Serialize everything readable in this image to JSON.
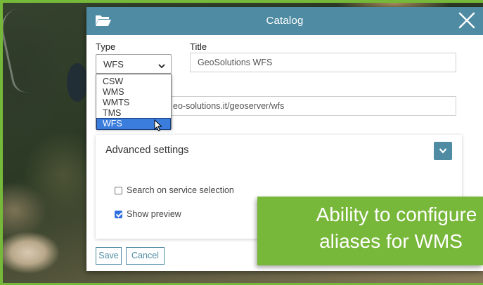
{
  "dialog": {
    "title": "Catalog",
    "icons": {
      "header": "folder-open-icon",
      "close": "close-icon",
      "toggle": "chevron-down-icon",
      "cursor": "mouse-pointer-icon"
    },
    "header_color": "#4f8ba3"
  },
  "form": {
    "type_label": "Type",
    "type_value": "WFS",
    "type_options": [
      "CSW",
      "WMS",
      "WMTS",
      "TMS",
      "WFS"
    ],
    "selected_option": "WFS",
    "title_label": "Title",
    "title_value": "GeoSolutions WFS",
    "url_value": "eo-solutions.it/geoserver/wfs"
  },
  "advanced": {
    "heading": "Advanced settings",
    "options": [
      {
        "label": "Search on service selection",
        "checked": false
      },
      {
        "label": "Show preview",
        "checked": true
      }
    ]
  },
  "buttons": {
    "save": "Save",
    "cancel": "Cancel"
  },
  "banner": {
    "line1": "Ability to configure",
    "line2": "aliases for WMS",
    "color": "#77b739"
  }
}
